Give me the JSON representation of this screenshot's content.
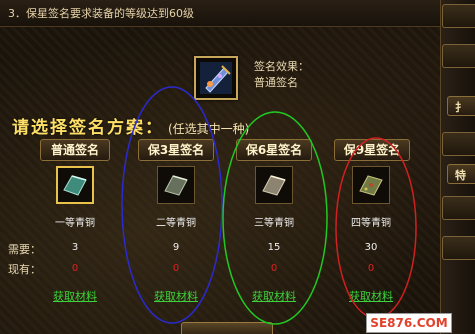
{
  "top_notice": "3．保星签名要求装备的等级达到60级",
  "signature": {
    "icon": "signature-scroll-icon",
    "effect_label": "签名效果：",
    "effect_value": "普通签名"
  },
  "heading": {
    "main": "请选择签名方案：",
    "sub": "(任选其中一种)"
  },
  "row_labels": {
    "required": "需要：",
    "owned": "现有："
  },
  "plans": [
    {
      "tab": "普通签名",
      "material": "一等青铜",
      "required": "3",
      "owned": "0",
      "link": "获取材料",
      "icon": "bronze-ingot-icon"
    },
    {
      "tab": "保3星签名",
      "material": "二等青铜",
      "required": "9",
      "owned": "0",
      "link": "获取材料",
      "icon": "bronze-ingot-icon"
    },
    {
      "tab": "保6星签名",
      "material": "三等青铜",
      "required": "15",
      "owned": "0",
      "link": "获取材料",
      "icon": "bronze-ingot-icon"
    },
    {
      "tab": "保9星签名",
      "material": "四等青铜",
      "required": "30",
      "owned": "0",
      "link": "获取材料",
      "icon": "bronze-ingot-icon"
    }
  ],
  "right_panel": {
    "btn1": "扌",
    "btn2": "特"
  },
  "watermark": "SE876.COM",
  "colors": {
    "gold_heading": "#ffe067",
    "green_link": "#3cd33c",
    "red_value": "#e02020",
    "ellipse_blue": "#2a2ad0",
    "ellipse_green": "#22c822",
    "ellipse_red": "#d02020"
  }
}
